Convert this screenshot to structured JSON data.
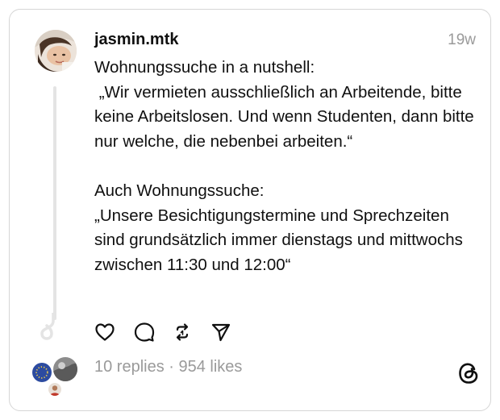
{
  "post": {
    "username": "jasmin.mtk",
    "timestamp": "19w",
    "text": "Wohnungssuche in a nutshell:\n „Wir vermieten ausschließlich an Arbeitende, bitte keine Arbeitslosen. Und wenn Studenten, dann bitte nur welche, die nebenbei arbeiten.“\n\nAuch Wohnungssuche:\n„Unsere Besichtigungstermine und Sprechzeiten sind grundsätzlich immer dienstags und mittwochs zwischen 11:30 und 12:00“",
    "stats": "10 replies · 954 likes"
  },
  "icons": {
    "like": "heart-icon",
    "reply": "comment-icon",
    "repost": "repost-icon",
    "share": "send-icon",
    "brand": "threads-logo"
  },
  "colors": {
    "text": "#101010",
    "muted": "#9a9a9a",
    "border": "#d6d6d6",
    "thread_line": "#e4e4e4"
  }
}
